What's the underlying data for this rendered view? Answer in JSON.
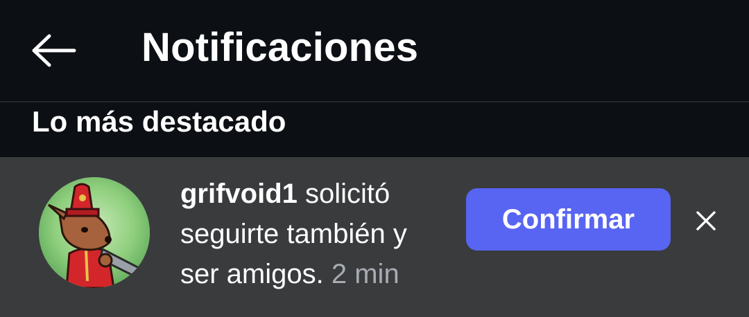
{
  "header": {
    "title": "Notificaciones",
    "back_icon": "arrow-left-icon"
  },
  "section": {
    "title": "Lo más destacado"
  },
  "notification": {
    "avatar_icon": "avatar-red-creature",
    "username": "grifvoid1",
    "message_part1": " solicitó seguirte también y ser amigos.",
    "time": "2 min",
    "confirm_label": "Confirmar",
    "dismiss_icon": "close-icon"
  },
  "colors": {
    "background": "#0c0f14",
    "card": "#3a3b3d",
    "accent": "#5865f2",
    "muted_text": "#a7acb3"
  }
}
